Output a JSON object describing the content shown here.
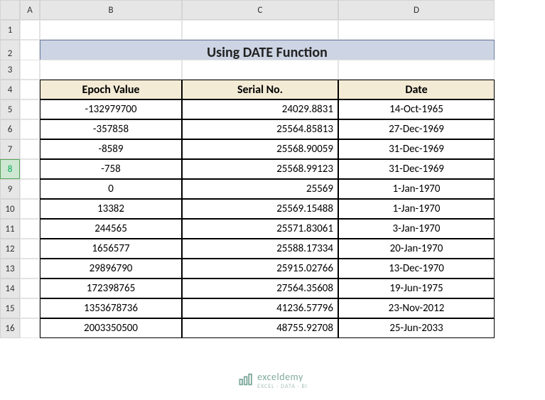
{
  "columns": [
    "A",
    "B",
    "C",
    "D"
  ],
  "row_numbers": [
    1,
    2,
    3,
    4,
    5,
    6,
    7,
    8,
    9,
    10,
    11,
    12,
    13,
    14,
    15,
    16
  ],
  "selected_row": 8,
  "title": "Using DATE Function",
  "headers": {
    "b": "Epoch Value",
    "c": "Serial No.",
    "d": "Date"
  },
  "chart_data": {
    "type": "table",
    "title": "Using DATE Function",
    "columns": [
      "Epoch Value",
      "Serial No.",
      "Date"
    ],
    "rows": [
      {
        "epoch": "-132979700",
        "serial": "24029.8831",
        "date": "14-Oct-1965"
      },
      {
        "epoch": "-357858",
        "serial": "25564.85813",
        "date": "27-Dec-1969"
      },
      {
        "epoch": "-8589",
        "serial": "25568.90059",
        "date": "31-Dec-1969"
      },
      {
        "epoch": "-758",
        "serial": "25568.99123",
        "date": "31-Dec-1969"
      },
      {
        "epoch": "0",
        "serial": "25569",
        "date": "1-Jan-1970"
      },
      {
        "epoch": "13382",
        "serial": "25569.15488",
        "date": "1-Jan-1970"
      },
      {
        "epoch": "244565",
        "serial": "25571.83061",
        "date": "3-Jan-1970"
      },
      {
        "epoch": "1656577",
        "serial": "25588.17334",
        "date": "20-Jan-1970"
      },
      {
        "epoch": "29896790",
        "serial": "25915.02766",
        "date": "13-Dec-1970"
      },
      {
        "epoch": "172398765",
        "serial": "27564.35608",
        "date": "19-Jun-1975"
      },
      {
        "epoch": "1353678736",
        "serial": "41236.57796",
        "date": "23-Nov-2012"
      },
      {
        "epoch": "2003350500",
        "serial": "48755.92708",
        "date": "25-Jun-2033"
      }
    ]
  },
  "watermark": {
    "name": "exceldemy",
    "tagline": "EXCEL · DATA · BI"
  }
}
